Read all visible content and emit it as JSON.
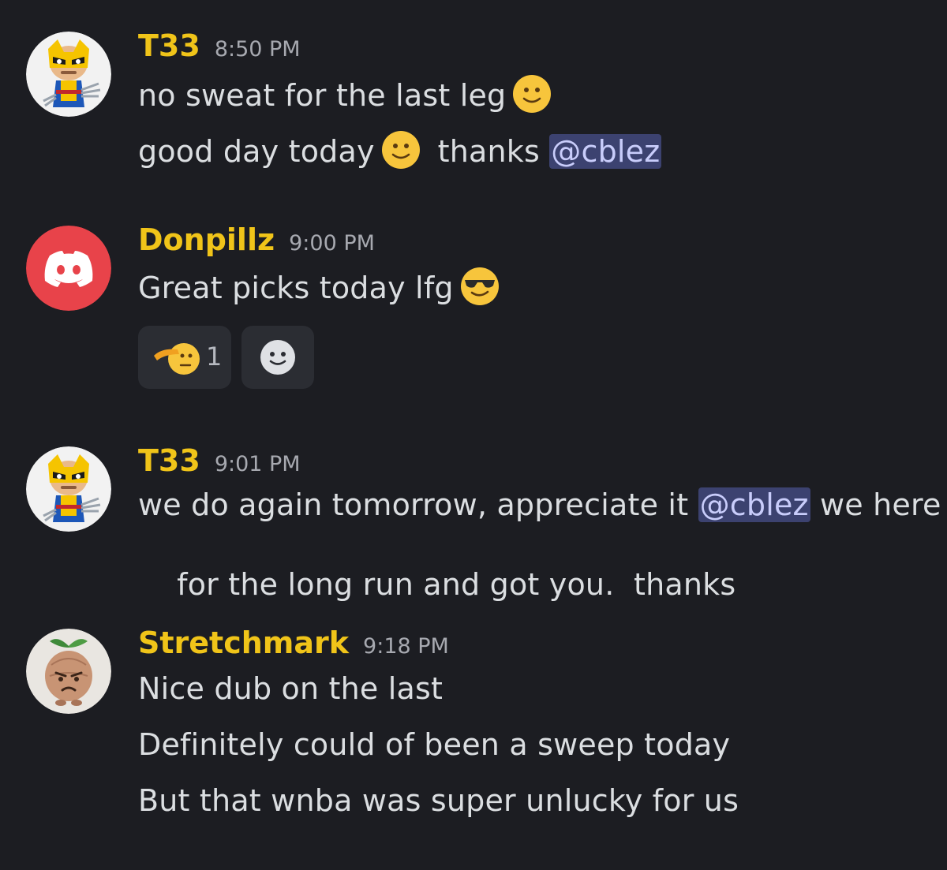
{
  "messages": [
    {
      "username": "T33",
      "timestamp": "8:50 PM",
      "avatar_icon": "wolverine-avatar-icon",
      "lines": {
        "l1": "no sweat for the last leg",
        "l2a": "good day today",
        "l2b": "thanks",
        "l2_mention": "@cblez"
      }
    },
    {
      "username": "Donpillz",
      "timestamp": "9:00 PM",
      "avatar_icon": "discord-logo-icon",
      "lines": {
        "l1": "Great picks today lfg"
      },
      "reactions": [
        {
          "emoji": "saluting-face-icon",
          "count": "1"
        },
        {
          "emoji": "add-reaction-smiley-icon"
        }
      ]
    },
    {
      "username": "T33",
      "timestamp": "9:01 PM",
      "avatar_icon": "wolverine-avatar-icon",
      "lines": {
        "l1a": "we do again tomorrow, appreciate it",
        "l1_mention": "@cblez",
        "l1b": "we here",
        "l2": "for the long run and got you.  thanks"
      }
    },
    {
      "username": "Stretchmark",
      "timestamp": "9:18 PM",
      "avatar_icon": "angry-sprout-avatar-icon",
      "lines": {
        "l1": "Nice dub on the last",
        "l2": "Definitely could of been a sweep today",
        "l3": "But that wnba was super unlucky for us"
      }
    }
  ],
  "colors": {
    "background": "#1c1d22",
    "username": "#f0c419",
    "timestamp": "#a7a9b0",
    "text": "#dbdee1",
    "mention_bg": "#3c4270",
    "mention_text": "#c9cdfb",
    "reaction_bg": "#2b2d33",
    "discord_red": "#e8434a"
  }
}
